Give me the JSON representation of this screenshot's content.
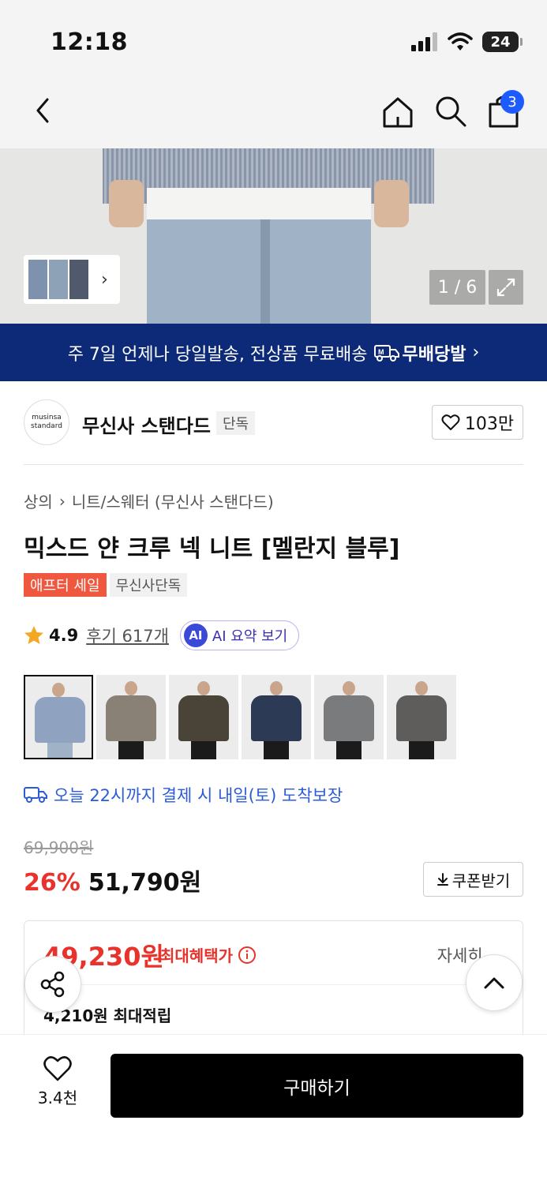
{
  "status_bar": {
    "time": "12:18",
    "battery": "24"
  },
  "nav": {
    "cart_count": "3"
  },
  "gallery": {
    "counter": "1 / 6"
  },
  "shipping_banner": {
    "text": "주 7일 언제나 당일발송, 전상품 무료배송",
    "brand": "무배당발"
  },
  "brand": {
    "logo_line1": "musinsa",
    "logo_line2": "standard",
    "name": "무신사 스탠다드",
    "tag": "단독",
    "likes": "103만"
  },
  "breadcrumb": {
    "level1": "상의",
    "level2": "니트/스웨터 (무신사 스탠다드)"
  },
  "product": {
    "title": "믹스드 얀 크루 넥 니트 [멜란지 블루]",
    "badge_sale": "애프터 세일",
    "badge_exclusive": "무신사단독",
    "rating": "4.9",
    "reviews": "후기 617개",
    "ai_icon": "AI",
    "ai_summary": "AI 요약 보기"
  },
  "color_options": [
    {
      "name": "멜란지 블루",
      "color": "#8fa3c0",
      "selected": true
    },
    {
      "name": "베이지",
      "color": "#8a8176"
    },
    {
      "name": "브라운",
      "color": "#4a4338"
    },
    {
      "name": "네이비",
      "color": "#2c3a55"
    },
    {
      "name": "그레이",
      "color": "#7a7b7d"
    },
    {
      "name": "차콜",
      "color": "#5e5d5b"
    }
  ],
  "delivery": {
    "text": "오늘 22시까지 결제 시 내일(토) 도착보장"
  },
  "price": {
    "original": "69,900원",
    "discount": "26%",
    "sale": "51,790원",
    "coupon_label": "쿠폰받기"
  },
  "benefit": {
    "max_price": "49,230원",
    "max_label": "최대혜택가",
    "detail": "자세히",
    "points": "4,210원 최대적립"
  },
  "bottom_bar": {
    "wish_count": "3.4천",
    "buy_label": "구매하기"
  },
  "colors": {
    "accent_red": "#e8322b",
    "brand_navy": "#0c2a78",
    "link_blue": "#2b5bd7",
    "badge_blue": "#1e5bff"
  }
}
